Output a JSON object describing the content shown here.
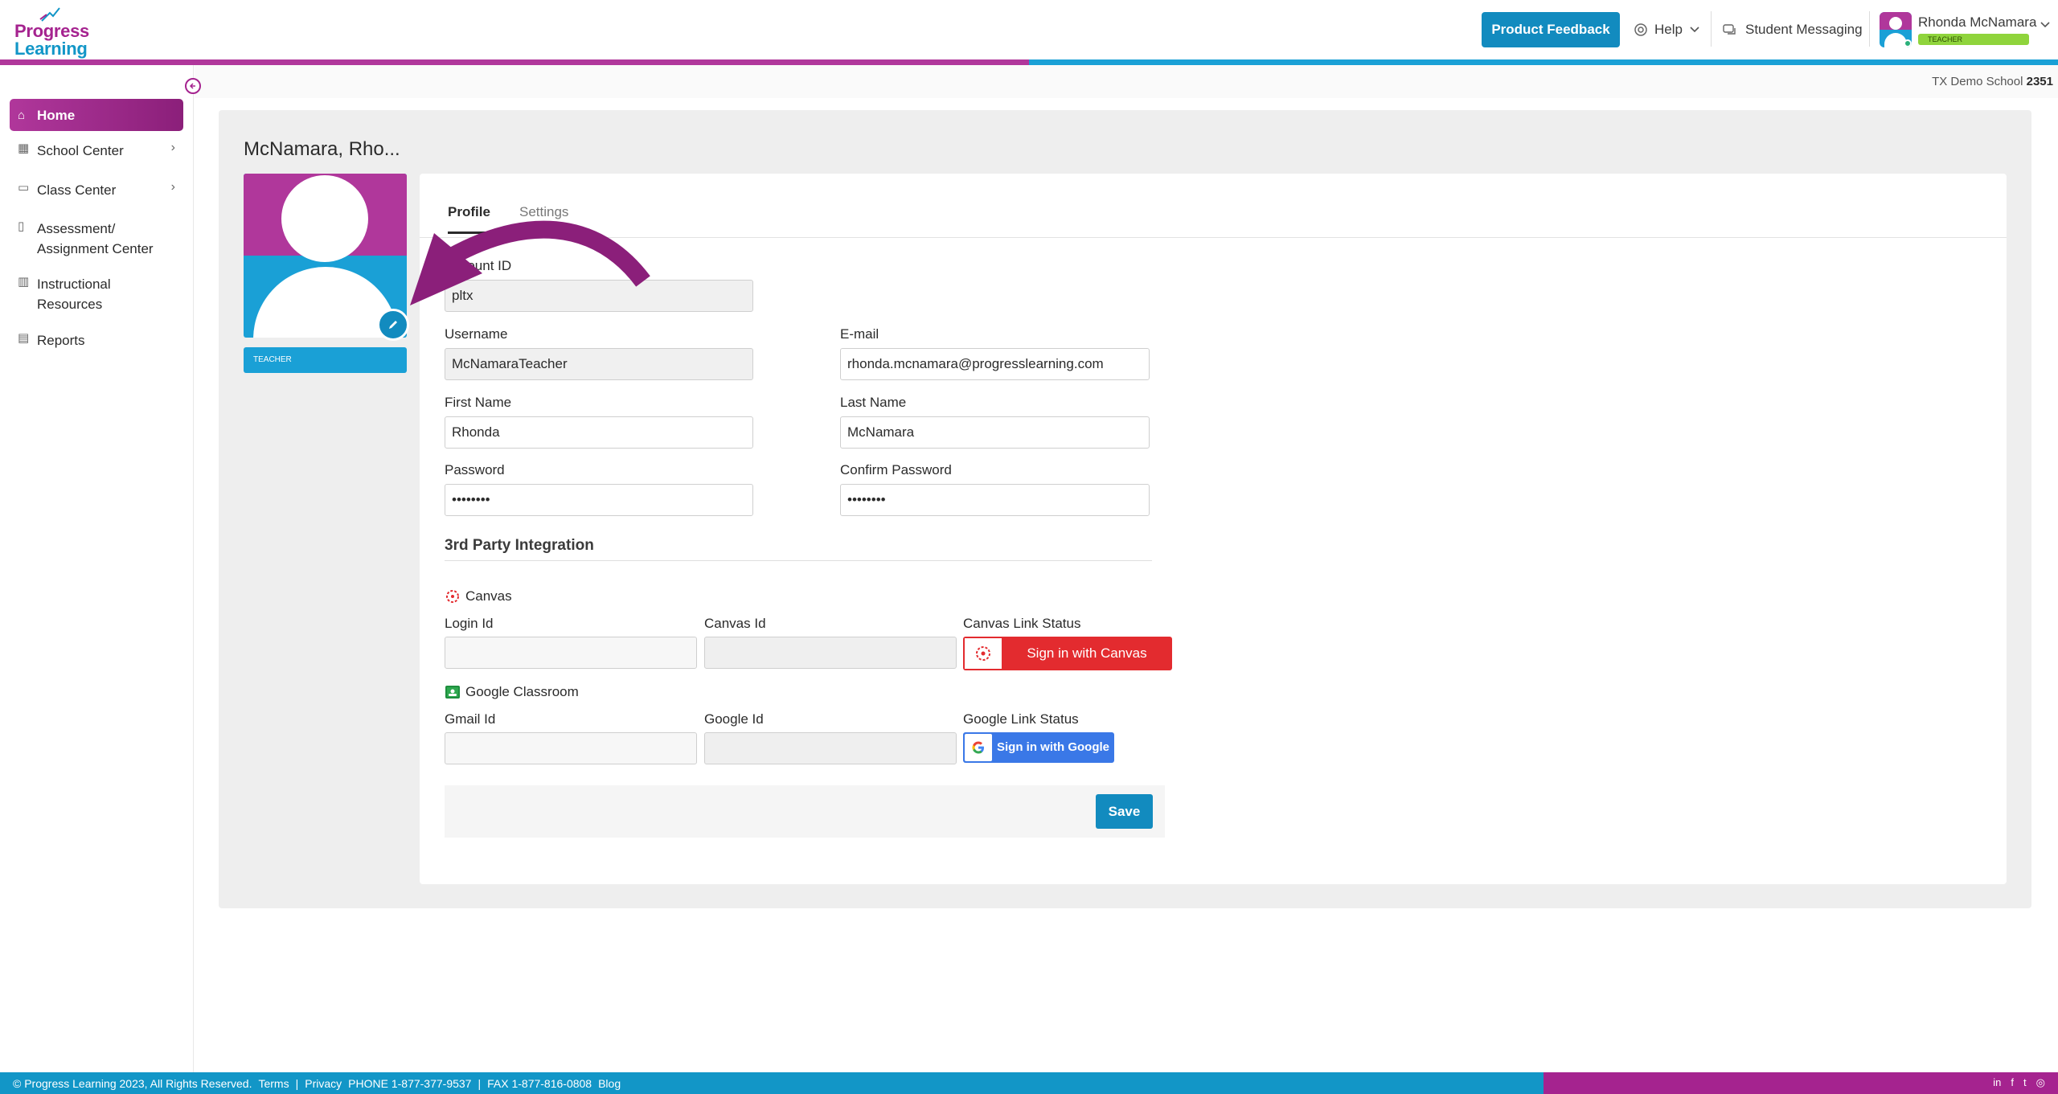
{
  "logo": {
    "line1": "Progress",
    "line2": "Learning"
  },
  "header": {
    "feedback_label": "Product Feedback",
    "help_label": "Help",
    "messaging_label": "Student Messaging",
    "user_name": "Rhonda McNamara",
    "user_role": "TEACHER"
  },
  "school": {
    "name": "TX Demo School",
    "id": "2351"
  },
  "sidebar": {
    "items": [
      {
        "label": "Home",
        "icon": "home-icon"
      },
      {
        "label": "School Center",
        "icon": "school-icon"
      },
      {
        "label": "Class Center",
        "icon": "class-icon"
      },
      {
        "label_line1": "Assessment/",
        "label_line2": "Assignment Center",
        "icon": "book-icon"
      },
      {
        "label_line1": "Instructional",
        "label_line2": "Resources",
        "icon": "book-open-icon"
      },
      {
        "label": "Reports",
        "icon": "report-icon"
      }
    ]
  },
  "profile": {
    "title": "McNamara, Rho...",
    "role_tag": "TEACHER",
    "tabs": [
      "Profile",
      "Settings"
    ],
    "fields": {
      "account_id_label": "Account ID",
      "account_id_visible_label": "ount ID",
      "account_id_value": "pltx",
      "username_label": "Username",
      "username_value": "McNamaraTeacher",
      "email_label": "E-mail",
      "email_value": "rhonda.mcnamara@progresslearning.com",
      "first_name_label": "First Name",
      "first_name_value": "Rhonda",
      "last_name_label": "Last Name",
      "last_name_value": "McNamara",
      "password_label": "Password",
      "password_value": "••••••••",
      "confirm_password_label": "Confirm Password",
      "confirm_password_value": "••••••••"
    },
    "integration": {
      "title": "3rd Party Integration",
      "canvas": {
        "name": "Canvas",
        "login_label": "Login Id",
        "id_label": "Canvas Id",
        "status_label": "Canvas Link Status",
        "button_label": "Sign in with Canvas"
      },
      "google": {
        "name": "Google Classroom",
        "login_label": "Gmail Id",
        "id_label": "Google Id",
        "status_label": "Google Link Status",
        "button_label": "Sign in with Google"
      }
    },
    "save_label": "Save"
  },
  "footer": {
    "copyright": "© Progress Learning 2023, All Rights Reserved.",
    "terms": "Terms",
    "divider": "|",
    "privacy": "Privacy",
    "phone": "PHONE 1-877-377-9537",
    "fax": "FAX 1-877-816-0808",
    "blog": "Blog"
  },
  "colors": {
    "brand_pink": "#b0379b",
    "brand_blue": "#1296c7",
    "canvas_red": "#e32b2f",
    "google_blue": "#3a78e7",
    "role_green": "#8fd43c"
  }
}
